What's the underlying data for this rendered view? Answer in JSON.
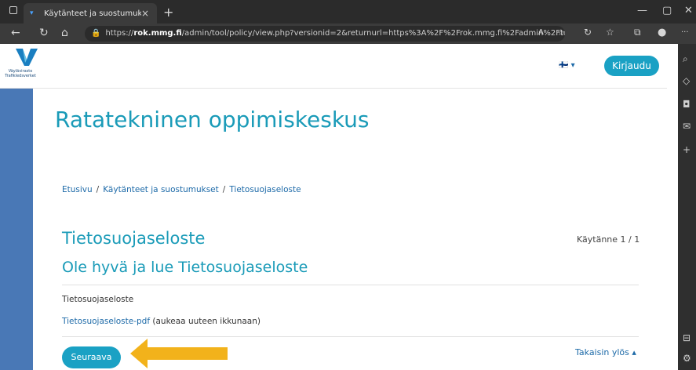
{
  "browser": {
    "tab_title": "Käytänteet ja suostumukset",
    "tab_close": "×",
    "new_tab": "+",
    "url_host": "https://rok.mmg.fi",
    "url_path": "/admin/tool/policy/view.php?versionid=2&returnurl=https%3A%2F%2Frok.mmg.fi%2Fadmin%2Ftool%2...",
    "win_minimize": "—",
    "win_maximize": "▢",
    "win_close": "✕",
    "back_icon": "←",
    "reload_icon": "↻",
    "home_icon": "⌂",
    "read_aloud_icon": "A",
    "favorite_icon": "☆",
    "extension_icon": "↻",
    "favorites_icon": "☆",
    "collections_icon": "⧉",
    "profile_icon": "●",
    "more_icon": "···"
  },
  "sidebar_icons": {
    "search": "⌕",
    "shopping": "◇",
    "office": "◘",
    "outlook": "✉",
    "add": "+",
    "split": "⊟",
    "settings": "⚙"
  },
  "header": {
    "logo_text": "Väylävirasto Trafikledsverket",
    "lang_label": "🇫🇮 ▾",
    "login_label": "Kirjaudu"
  },
  "site_title": "Ratatekninen oppimiskeskus",
  "breadcrumb": {
    "home": "Etusivu",
    "policies": "Käytänteet ja suostumukset",
    "current": "Tietosuojaseloste",
    "separator": "/"
  },
  "policy": {
    "heading": "Tietosuojaseloste",
    "count": "Käytänne 1 / 1",
    "subheading": "Ole hyvä ja lue Tietosuojaseloste",
    "name": "Tietosuojaseloste",
    "pdf_link": "Tietosuojaseloste-pdf",
    "pdf_note": " (aukeaa uuteen ikkunaan)"
  },
  "actions": {
    "next_label": "Seuraava",
    "back_to_top": "Takaisin ylös ▴"
  },
  "colors": {
    "accent": "#1aa1c4",
    "title": "#1a9bb8",
    "link": "#1d6aa8",
    "left_bar": "#4978b6",
    "arrow": "#f2b21b"
  }
}
